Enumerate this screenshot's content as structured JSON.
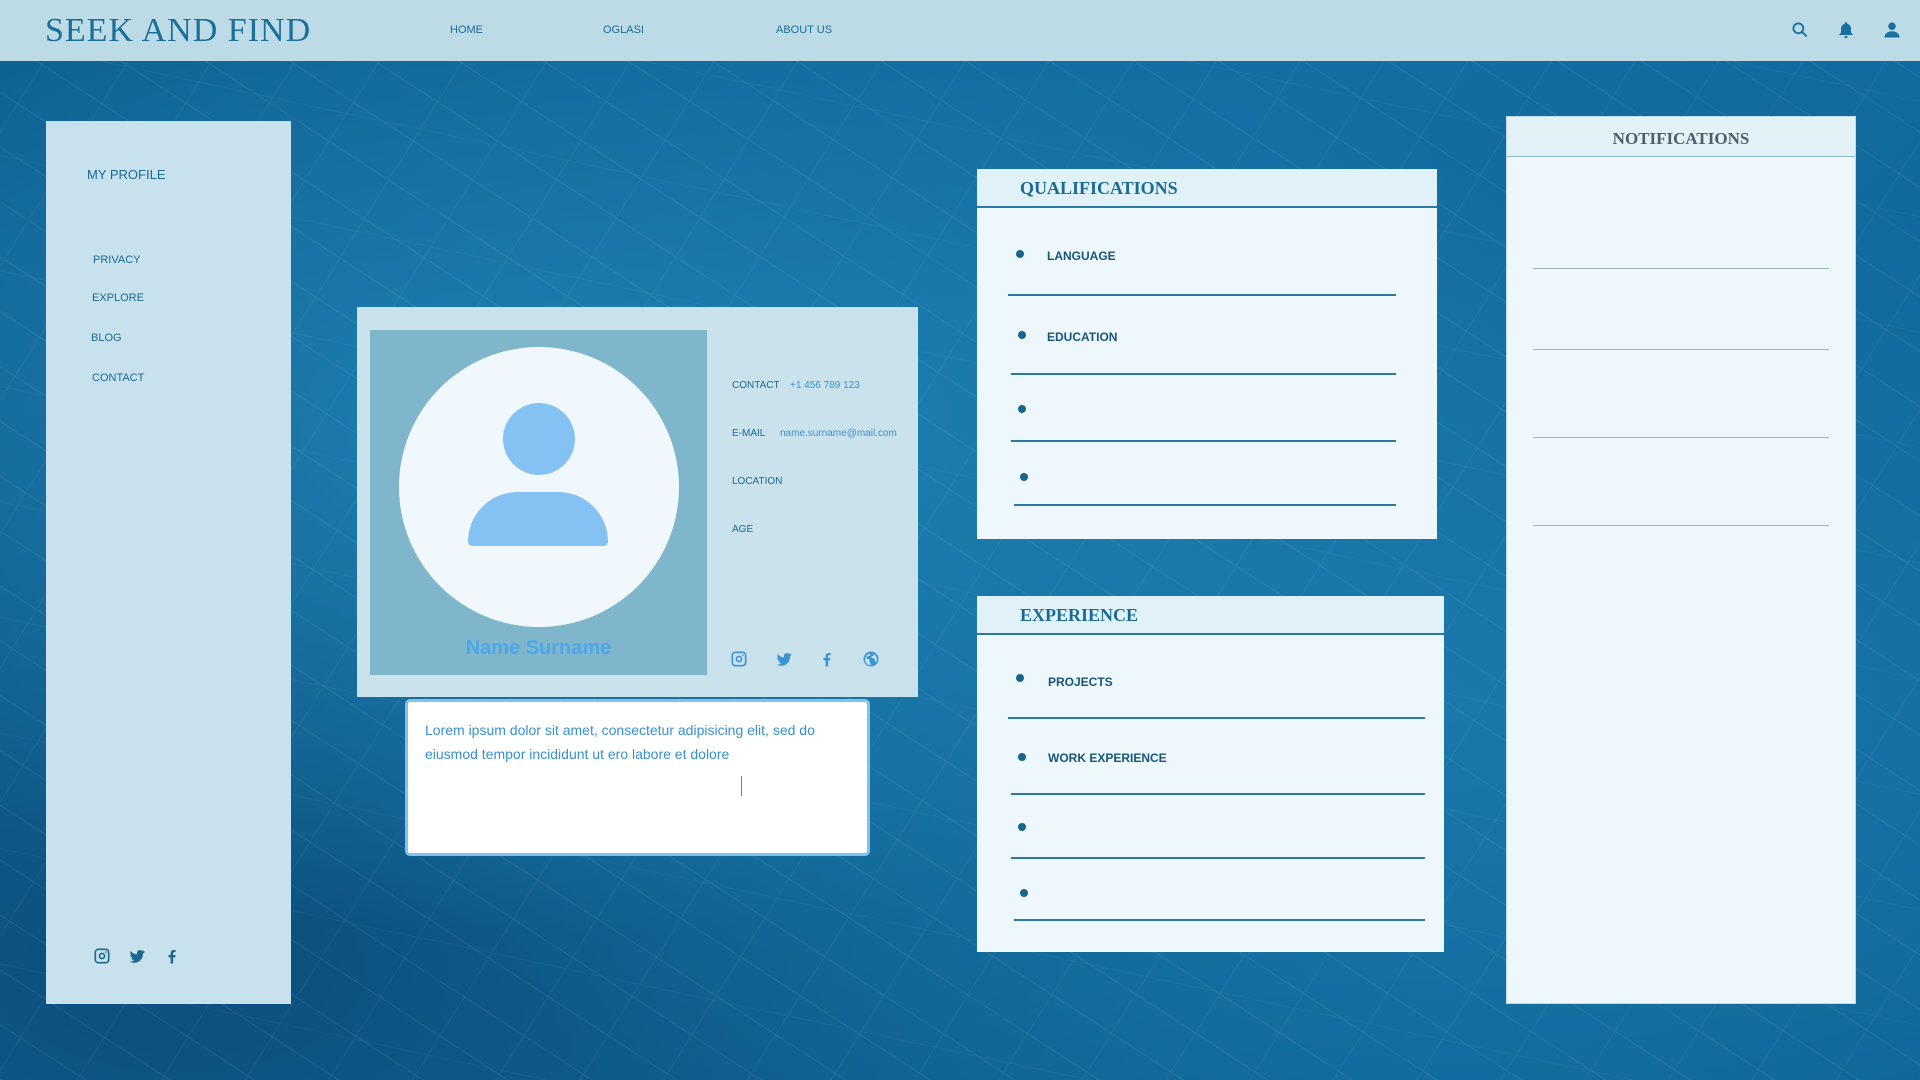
{
  "header": {
    "brand": "SEEK AND FIND",
    "nav": [
      "HOME",
      "OGLASI",
      "ABOUT US"
    ],
    "icons": [
      "search-icon",
      "bell-icon",
      "user-icon"
    ]
  },
  "sidebar": {
    "title": "MY PROFILE",
    "items": [
      "PRIVACY",
      "EXPLORE",
      "BLOG",
      "CONTACT"
    ],
    "social": [
      "instagram-icon",
      "twitter-icon",
      "facebook-icon"
    ]
  },
  "profile": {
    "name": "Name Surname",
    "contact_label": "CONTACT",
    "contact_value": "+1 456 789 123",
    "email_label": "E-MAIL",
    "email_value": "name.surname@mail.com",
    "location_label": "LOCATION",
    "age_label": "AGE",
    "social": [
      "instagram-icon",
      "twitter-icon",
      "facebook-icon",
      "globe-icon"
    ]
  },
  "bio": {
    "text": "Lorem ipsum dolor sit amet, consectetur adipisicing elit, sed do eiusmod tempor incididunt ut ero labore et dolore"
  },
  "qualifications": {
    "title": "QUALIFICATIONS",
    "items": [
      "LANGUAGE",
      "EDUCATION",
      "",
      ""
    ]
  },
  "experience": {
    "title": "EXPERIENCE",
    "items": [
      "PROJECTS",
      "WORK EXPERIENCE",
      "",
      ""
    ]
  },
  "notifications": {
    "title": "NOTIFICATIONS"
  },
  "colors": {
    "topbar": "#bddbe6",
    "panel": "#c7e2ec",
    "accent": "#1a6f9d",
    "link": "#3b93d6"
  }
}
